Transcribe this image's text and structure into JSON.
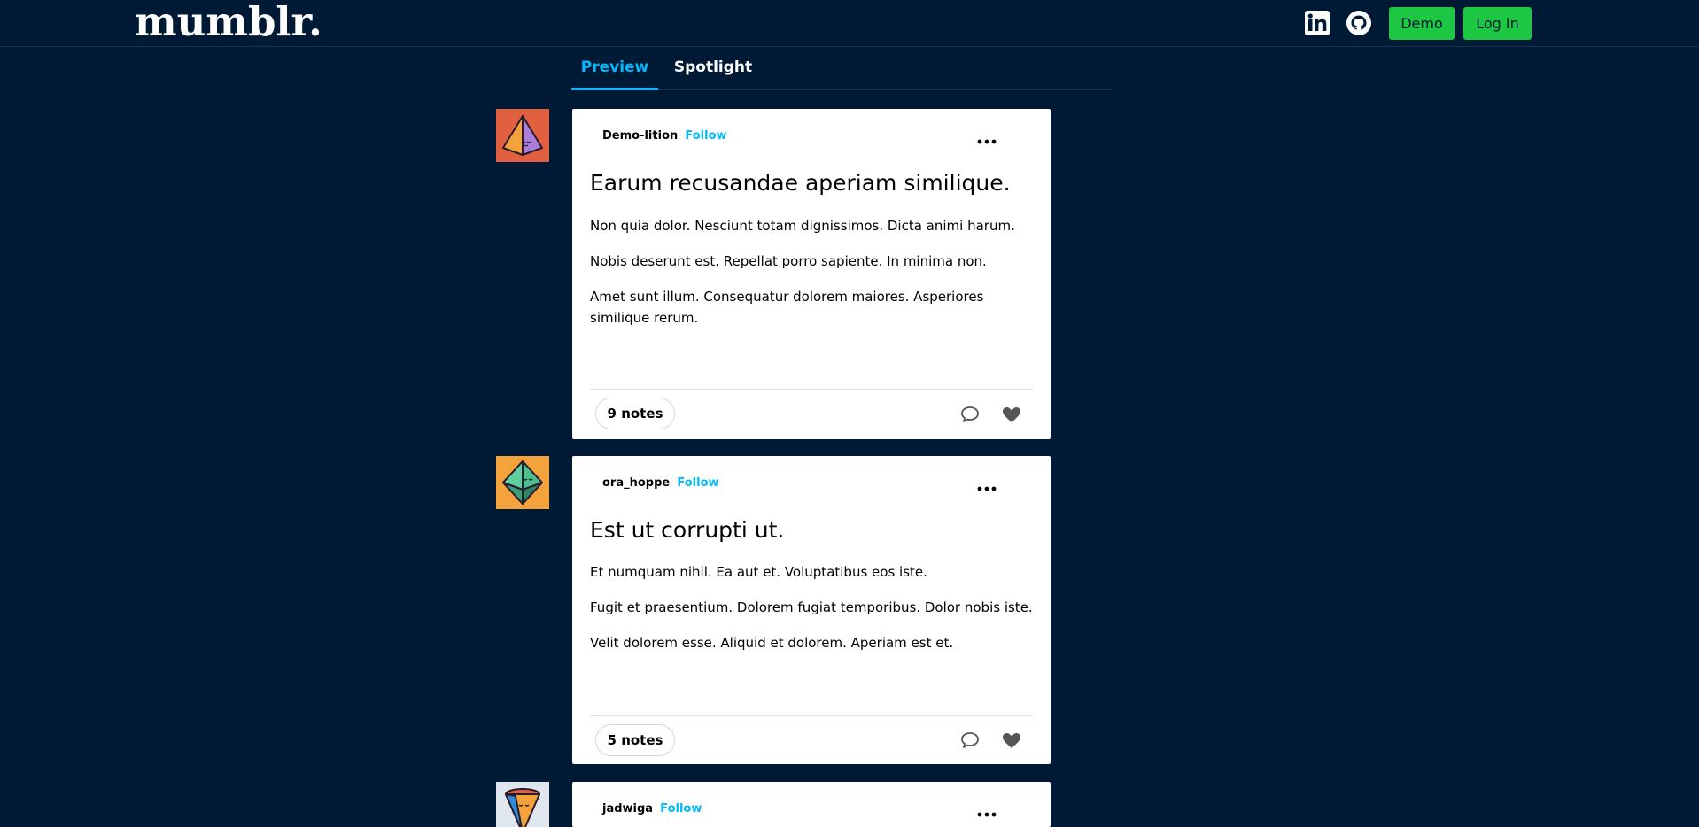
{
  "app": {
    "logo": "mumblr."
  },
  "header": {
    "linkedin_icon": "linkedin-icon",
    "github_icon": "github-icon",
    "demo_label": "Demo",
    "login_label": "Log In"
  },
  "tabs": [
    {
      "label": "Preview",
      "active": true
    },
    {
      "label": "Spotlight",
      "active": false
    }
  ],
  "posts": [
    {
      "author": "Demo-lition",
      "follow": "Follow",
      "title": "Earum recusandae aperiam similique.",
      "paragraphs": [
        "Non quia dolor. Nesciunt totam dignissimos. Dicta animi harum.",
        "Nobis deserunt est. Repellat porro sapiente. In minima non.",
        "Amet sunt illum. Consequatur dolorem maiores. Asperiores similique rerum."
      ],
      "notes": "9 notes",
      "avatar": {
        "bg": "#e0603f",
        "icon": "pyramid-avatar-icon"
      }
    },
    {
      "author": "ora_hoppe",
      "follow": "Follow",
      "title": "Est ut corrupti ut.",
      "paragraphs": [
        "Et numquam nihil. Ea aut et. Voluptatibus eos iste.",
        "Fugit et praesentium. Dolorem fugiat temporibus. Dolor nobis iste.",
        "Velit dolorem esse. Aliquid et dolorem. Aperiam est et."
      ],
      "notes": "5 notes",
      "avatar": {
        "bg": "#f4a23c",
        "icon": "octahedron-avatar-icon"
      }
    },
    {
      "author": "jadwiga",
      "follow": "Follow",
      "avatar": {
        "bg": "#dfe6ee",
        "icon": "cone-avatar-icon"
      }
    }
  ],
  "colors": {
    "background": "#001935",
    "accent": "#00b8ff",
    "button_green": "#1ec743"
  }
}
